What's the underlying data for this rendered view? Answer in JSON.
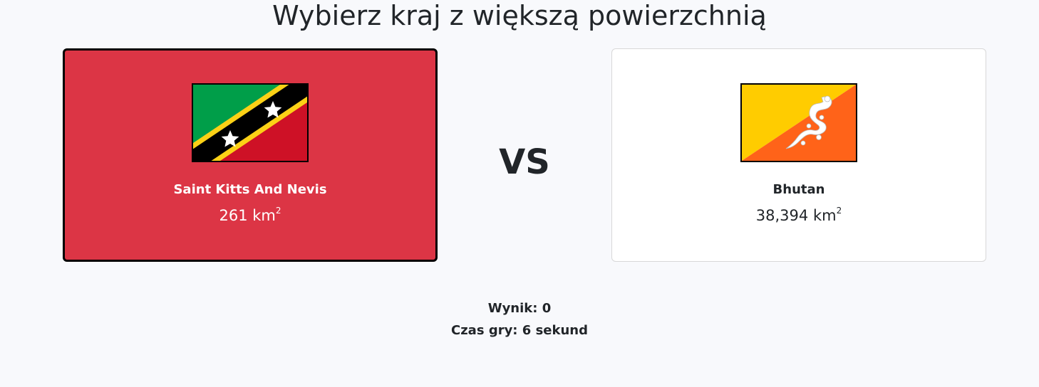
{
  "title": "Wybierz kraj z większą powierzchnią",
  "vs_label": "VS",
  "unit": "km",
  "unit_sup": "2",
  "left_country": {
    "name": "Saint Kitts And Nevis",
    "area": "261",
    "flag_icon": "saint-kitts-and-nevis-flag",
    "background_color": "#dc3545"
  },
  "right_country": {
    "name": "Bhutan",
    "area": "38,394",
    "flag_icon": "bhutan-flag",
    "background_color": "#ffffff"
  },
  "stats": {
    "score": "Wynik: 0",
    "time": "Czas gry: 6 sekund"
  }
}
